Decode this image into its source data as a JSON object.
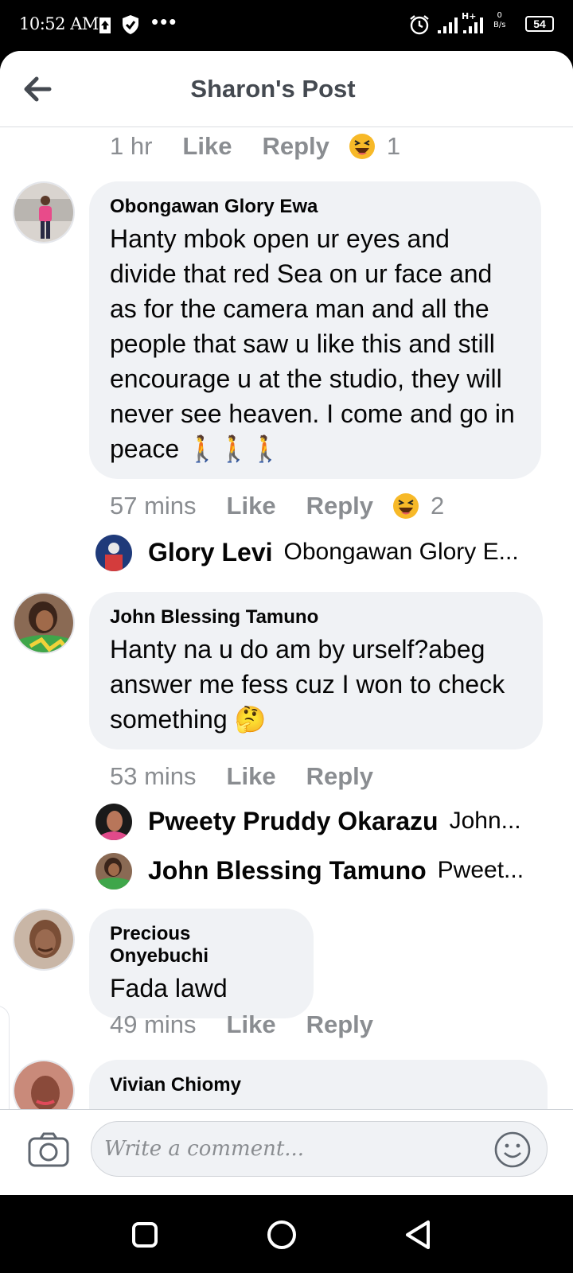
{
  "status_bar": {
    "time": "10:52 AM",
    "net_speed_value": "0",
    "net_speed_unit": "B/s",
    "battery": "54",
    "icons": [
      "upload-icon",
      "shield-icon",
      "more-dots-icon",
      "alarm-icon",
      "signal-icon",
      "signal-h-plus-icon",
      "battery-icon"
    ]
  },
  "header": {
    "title": "Sharon's Post",
    "back_icon": "back-arrow-icon"
  },
  "feed": {
    "top_meta": {
      "time": "1 hr",
      "like": "Like",
      "reply": "Reply",
      "reaction_icon": "haha-emoji-icon",
      "reaction_count": "1"
    },
    "comments": [
      {
        "author": "Obongawan Glory Ewa",
        "text": "Hanty mbok open ur eyes and divide that red Sea on ur face and as for the camera man and all the people that saw u like this and still encourage u at the studio, they will never see heaven. I come and go in peace 🚶🚶🚶",
        "time": "57 mins",
        "like": "Like",
        "reply": "Reply",
        "reaction_icon": "haha-emoji-icon",
        "reaction_count": "2",
        "replies": [
          {
            "name": "Glory Levi",
            "preview": "Obongawan Glory E..."
          }
        ]
      },
      {
        "author": "John Blessing Tamuno",
        "text": "Hanty na u do am by urself?abeg answer me fess cuz I won to check something 🤔",
        "time": "53 mins",
        "like": "Like",
        "reply": "Reply",
        "replies": [
          {
            "name": "Pweety Pruddy Okarazu",
            "preview": "John..."
          },
          {
            "name": "John Blessing Tamuno",
            "preview": "Pweet..."
          }
        ]
      },
      {
        "author": "Precious Onyebuchi",
        "text": "Fada lawd",
        "time": "49 mins",
        "like": "Like",
        "reply": "Reply"
      },
      {
        "author": "Vivian Chiomy"
      }
    ]
  },
  "composer": {
    "placeholder": "Write a comment...",
    "camera_icon": "camera-icon",
    "emoji_icon": "smiley-icon"
  },
  "nav_bar": {
    "icons": [
      "recents-square-icon",
      "home-circle-icon",
      "back-triangle-icon"
    ]
  },
  "colors": {
    "bubble": "#f0f2f5",
    "meta_text": "#8a8d91",
    "title_text": "#444950"
  }
}
